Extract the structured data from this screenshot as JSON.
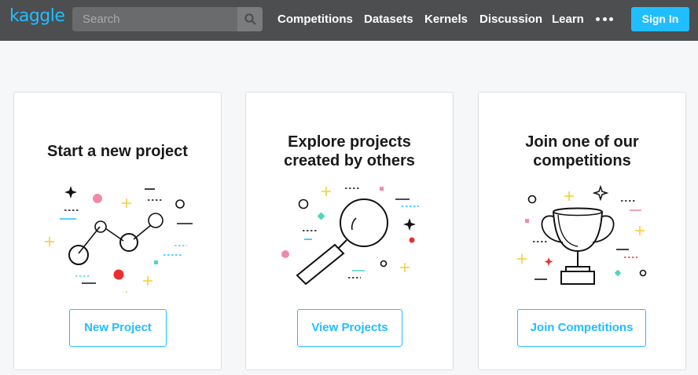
{
  "header": {
    "logo": "kaggle",
    "search_placeholder": "Search",
    "nav": [
      "Competitions",
      "Datasets",
      "Kernels",
      "Discussion",
      "Learn"
    ],
    "signin_label": "Sign In"
  },
  "cards": [
    {
      "title": "Start a new project",
      "button": "New Project"
    },
    {
      "title": "Explore projects\ncreated by others",
      "button": "View Projects"
    },
    {
      "title": "Join one of our\ncompetitions",
      "button": "Join Competitions"
    }
  ],
  "colors": {
    "accent": "#20beff",
    "topbar": "#4d4e50",
    "confetti_yellow": "#f5cf3a",
    "confetti_pink": "#f08aa8",
    "confetti_red": "#e8302f",
    "confetti_teal": "#50d4c4",
    "confetti_blue": "#20beff"
  },
  "icons": [
    "search-icon",
    "more-icon",
    "network-graph-icon",
    "magnifier-icon",
    "trophy-icon"
  ]
}
